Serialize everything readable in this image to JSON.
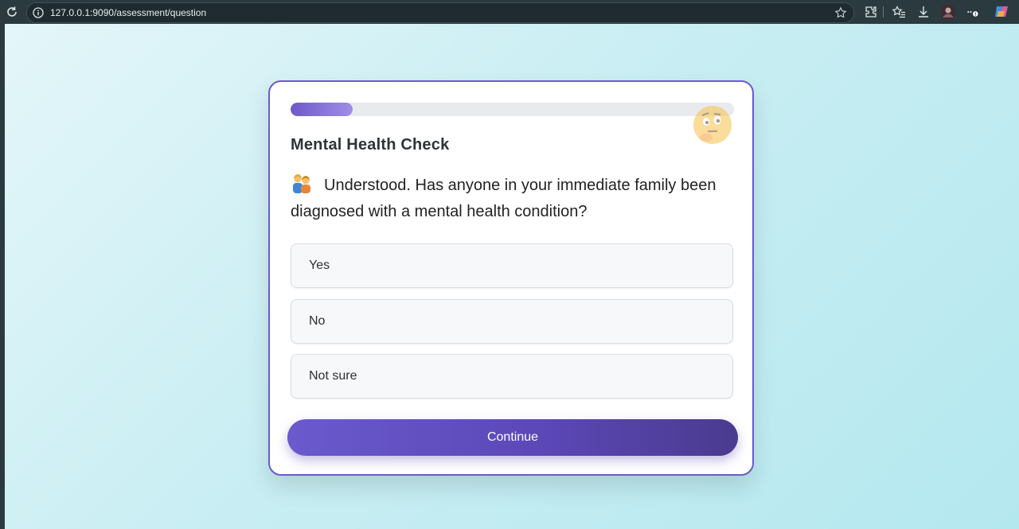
{
  "browser": {
    "url": "127.0.0.1:9090/assessment/question"
  },
  "assessment": {
    "title": "Mental Health Check",
    "progress_percent": 14,
    "question": "Understood. Has anyone in your immediate family been diagnosed with a mental health condition?",
    "options": [
      {
        "label": "Yes"
      },
      {
        "label": "No"
      },
      {
        "label": "Not sure"
      }
    ],
    "continue_label": "Continue"
  },
  "colors": {
    "accent": "#6a5acd",
    "background": "#c9eef3"
  },
  "icons": {
    "refresh": "refresh-icon",
    "info": "info-icon",
    "star": "favorite-star-icon",
    "extensions": "extensions-icon",
    "favorites": "favorites-icon",
    "downloads": "download-icon",
    "profile": "avatar",
    "more": "more-icon",
    "copilot": "copilot-icon",
    "family": "family-icon",
    "thinking": "thinking-face-icon"
  }
}
